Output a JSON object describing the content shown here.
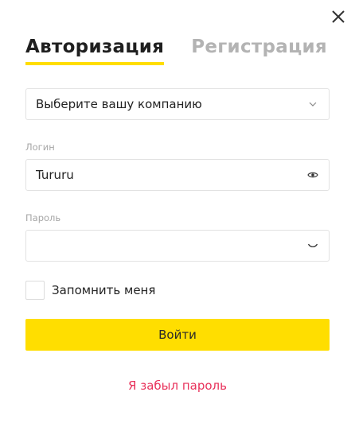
{
  "tabs": {
    "login": "Авторизация",
    "register": "Регистрация"
  },
  "company": {
    "selected": "Выберите вашу компанию",
    "icon": "chevron-down-icon"
  },
  "login": {
    "label": "Логин",
    "value": "Tururu",
    "icon": "eye-icon"
  },
  "password": {
    "label": "Пароль",
    "value": "",
    "icon": "eye-closed-icon"
  },
  "remember": {
    "label": "Запомнить меня",
    "checked": false
  },
  "submit_label": "Войти",
  "forgot_label": "Я забыл пароль",
  "colors": {
    "accent": "#ffde00",
    "link": "#e8325b",
    "inactive_tab": "#b3b3b3"
  }
}
